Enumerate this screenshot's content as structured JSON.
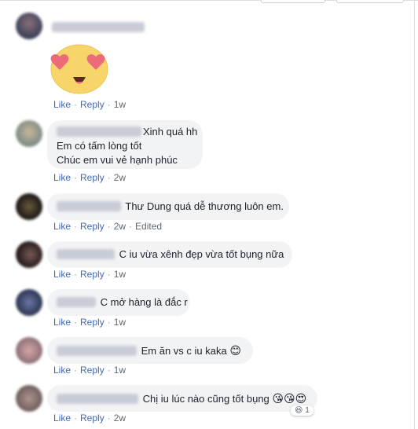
{
  "actions": {
    "like": "Like",
    "reply": "Reply",
    "dot": "·",
    "edited": "Edited"
  },
  "sticker": {
    "icon": "heart-eyes-sticker"
  },
  "comments": [
    {
      "time": "1w"
    },
    {
      "lines": [
        "Xinh quá hh",
        "Em có tấm lòng tốt",
        "Chúc em vui vẻ hạnh phúc"
      ],
      "time": "2w"
    },
    {
      "text": "Thư Dung quá dễ thương luôn em.",
      "time": "2w"
    },
    {
      "text": "C iu vừa xênh đẹp vừa tốt bụng nữa",
      "time": "1w"
    },
    {
      "text": "C mở hàng là đắc r",
      "time": "1w"
    },
    {
      "text": "Em ăn vs c iu kaka",
      "emoji": "😊",
      "time": "1w"
    },
    {
      "text": "Chị iu lúc nào cũng tốt bụng",
      "emoji": "😘😘😍",
      "time": "2w",
      "reaction": {
        "emoji": "😆",
        "count": "1"
      }
    }
  ]
}
